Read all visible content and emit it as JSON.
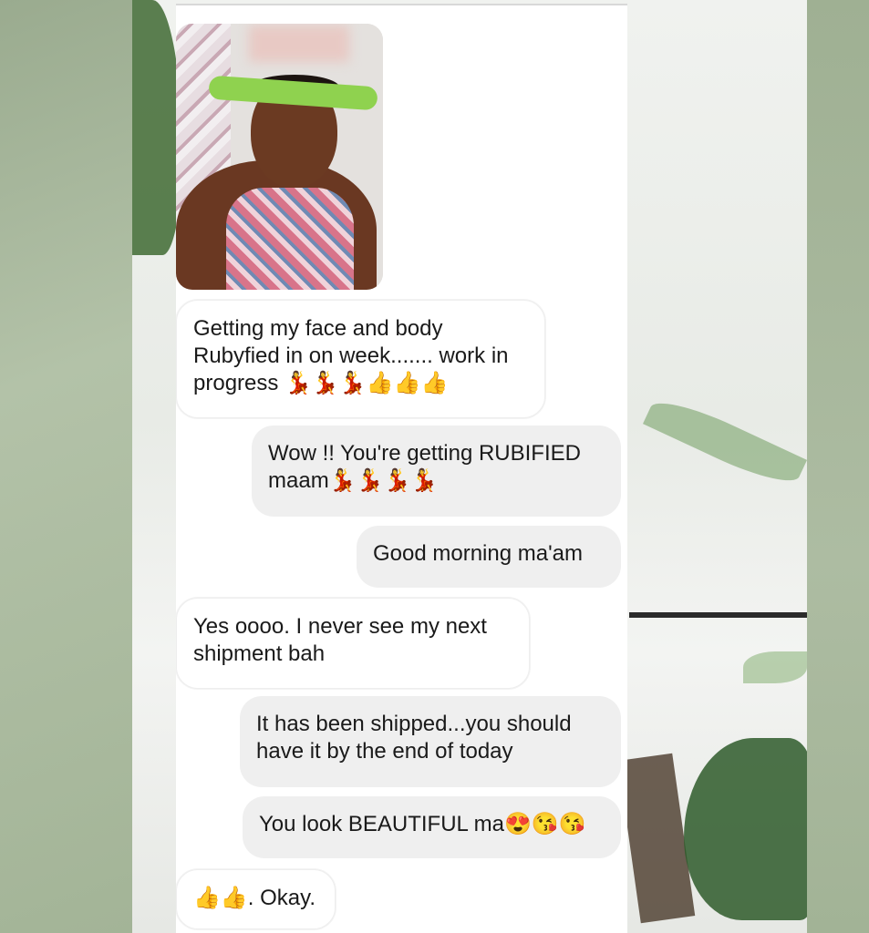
{
  "conversation": {
    "photo_message": {
      "alt_icon": "user-photo"
    },
    "messages": [
      {
        "side": "incoming",
        "text": "Getting my face and body\nRubyfied in on week....... work in\nprogress 💃💃💃👍👍👍"
      },
      {
        "side": "outgoing",
        "text": "Wow !! You're getting RUBIFIED\nmaam💃💃💃💃"
      },
      {
        "side": "outgoing",
        "text": "Good morning ma'am"
      },
      {
        "side": "incoming",
        "text": "Yes oooo. I never see my next\nshipment bah"
      },
      {
        "side": "outgoing",
        "text": "It has been shipped...you should\nhave it by the end of today"
      },
      {
        "side": "outgoing",
        "text": "You look BEAUTIFUL ma😍😘😘"
      },
      {
        "side": "incoming",
        "text": "👍👍. Okay."
      }
    ]
  },
  "colors": {
    "background_green": "#a6b79b",
    "incoming_bubble": "#ffffff",
    "outgoing_bubble": "#efefef",
    "text": "#1a1a1a"
  }
}
